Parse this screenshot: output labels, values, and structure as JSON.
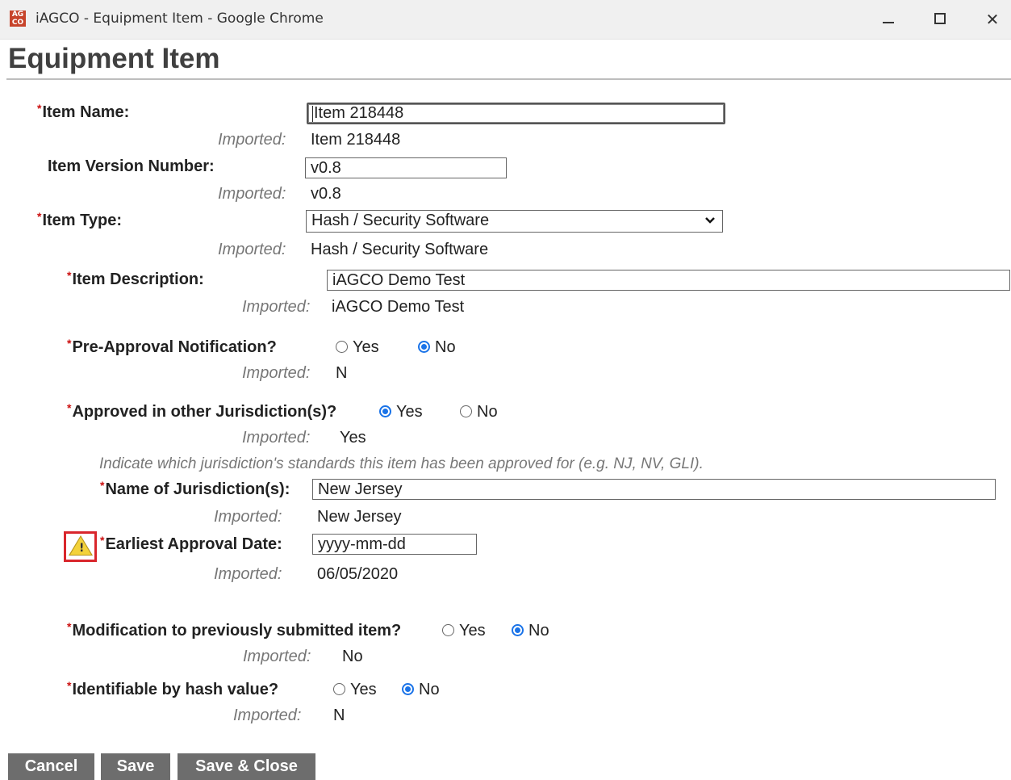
{
  "window": {
    "app_icon_text": "AG CO",
    "title": "iAGCO - Equipment Item - Google Chrome",
    "minimize_icon": "minimize-icon",
    "maximize_icon": "maximize-icon",
    "close_icon": "close-icon",
    "close_glyph": "✕"
  },
  "page": {
    "title": "Equipment Item"
  },
  "imported_label": "Imported:",
  "required_mark": "*",
  "item_name": {
    "label": "Item Name:",
    "value": "Item 218448",
    "imported": "Item 218448"
  },
  "item_version": {
    "label": "Item Version Number:",
    "value": "v0.8",
    "imported": "v0.8"
  },
  "item_type": {
    "label": "Item Type:",
    "value": "Hash / Security Software",
    "imported": "Hash / Security Software",
    "arrow": "⌄"
  },
  "item_description": {
    "label": "Item Description:",
    "value": "iAGCO Demo Test",
    "imported": "iAGCO Demo Test"
  },
  "pre_approval": {
    "label": "Pre-Approval Notification?",
    "yes": "Yes",
    "no": "No",
    "selected": "No",
    "imported": "N"
  },
  "approved_other": {
    "label": "Approved in other Jurisdiction(s)?",
    "yes": "Yes",
    "no": "No",
    "selected": "Yes",
    "imported": "Yes"
  },
  "jurisdiction_hint": "Indicate which jurisdiction's standards this item has been approved for (e.g. NJ, NV, GLI).",
  "jurisdiction_name": {
    "label": "Name of Jurisdiction(s):",
    "value": "New Jersey",
    "imported": "New Jersey"
  },
  "approval_date": {
    "label": "Earliest Approval Date:",
    "value": "yyyy-mm-dd",
    "imported": "06/05/2020",
    "warning_icon": "warning-icon",
    "warning_glyph": "!",
    "warning_color": "#d9262c"
  },
  "modification": {
    "label": "Modification to previously submitted item?",
    "yes": "Yes",
    "no": "No",
    "selected": "No",
    "imported": "No"
  },
  "hash_identifiable": {
    "label": "Identifiable by hash value?",
    "yes": "Yes",
    "no": "No",
    "selected": "No",
    "imported": "N"
  },
  "buttons": {
    "cancel": "Cancel",
    "save": "Save",
    "save_close": "Save & Close"
  },
  "colors": {
    "required": "#cc1111",
    "radio_selected": "#1a73e8",
    "button_bg": "#6d6d6d"
  }
}
